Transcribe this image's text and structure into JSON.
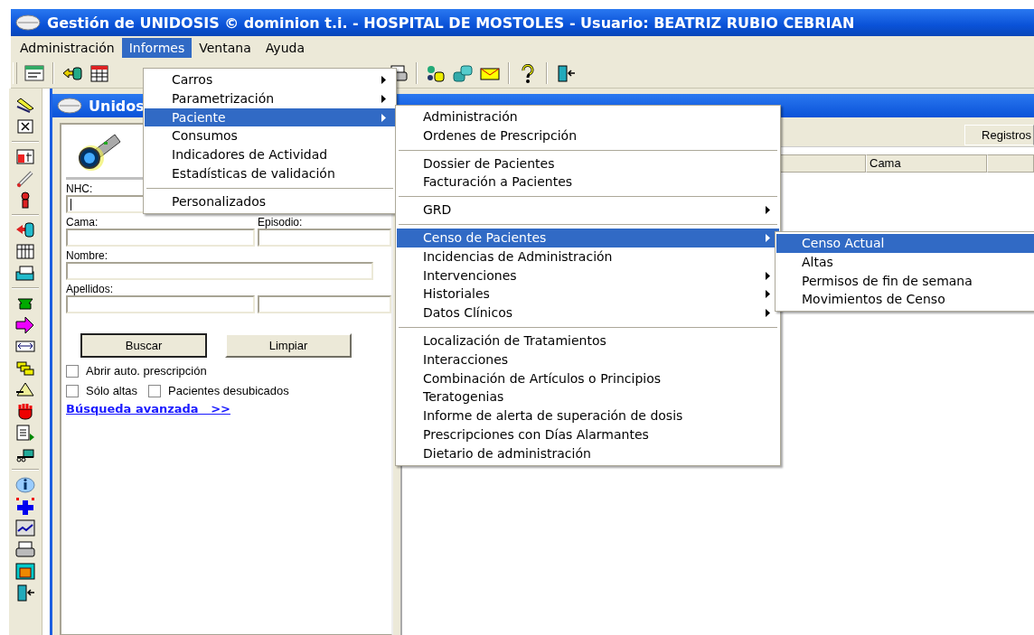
{
  "window": {
    "title": "Gestión de UNIDOSIS © dominion t.i. - HOSPITAL DE MOSTOLES - Usuario: BEATRIZ RUBIO CEBRIAN"
  },
  "menubar": [
    {
      "label": "Administración",
      "selected": false
    },
    {
      "label": "Informes",
      "selected": true
    },
    {
      "label": "Ventana",
      "selected": false
    },
    {
      "label": "Ayuda",
      "selected": false
    }
  ],
  "child_window": {
    "title": "Unidos"
  },
  "search_form": {
    "fields": [
      {
        "label": "NHC:",
        "kind": "full",
        "focused": true
      },
      {
        "label": "Cama:",
        "kind": "half"
      },
      {
        "label": "Episodio:",
        "kind": "half"
      },
      {
        "label": "Nombre:",
        "kind": "wide"
      },
      {
        "label": "Apellidos:",
        "kind": "half"
      },
      {
        "kind": "half"
      }
    ],
    "buttons": [
      {
        "label": "Buscar",
        "default": true
      },
      {
        "label": "Limpiar",
        "default": false
      }
    ],
    "checkboxes": [
      [
        {
          "label": "Abrir auto. prescripción",
          "checked": false
        }
      ],
      [
        {
          "label": "Sólo altas",
          "checked": false
        },
        {
          "label": "Pacientes desubicados",
          "checked": false
        }
      ]
    ],
    "link": "Búsqueda avanzada   >>"
  },
  "results": {
    "button": "Registros",
    "columns": [
      "Cama"
    ]
  },
  "menus": [
    {
      "items": [
        {
          "kind": "item",
          "label": "Carros",
          "submenu": true,
          "selected": false
        },
        {
          "kind": "item",
          "label": "Parametrización",
          "submenu": true,
          "selected": false
        },
        {
          "kind": "item",
          "label": "Paciente",
          "submenu": true,
          "selected": true
        },
        {
          "kind": "item",
          "label": "Consumos",
          "submenu": false,
          "selected": false
        },
        {
          "kind": "item",
          "label": "Indicadores de Actividad",
          "submenu": false,
          "selected": false
        },
        {
          "kind": "item",
          "label": "Estadísticas de validación",
          "submenu": false,
          "selected": false
        },
        {
          "kind": "separator"
        },
        {
          "kind": "item",
          "label": "Personalizados",
          "submenu": false,
          "selected": false
        }
      ]
    },
    {
      "items": [
        {
          "kind": "item",
          "label": "Administración",
          "submenu": false,
          "selected": false
        },
        {
          "kind": "item",
          "label": "Ordenes de Prescripción",
          "submenu": false,
          "selected": false
        },
        {
          "kind": "separator"
        },
        {
          "kind": "item",
          "label": "Dossier de Pacientes",
          "submenu": false,
          "selected": false
        },
        {
          "kind": "item",
          "label": "Facturación a Pacientes",
          "submenu": false,
          "selected": false
        },
        {
          "kind": "separator"
        },
        {
          "kind": "item",
          "label": "GRD",
          "submenu": true,
          "selected": false
        },
        {
          "kind": "separator"
        },
        {
          "kind": "item",
          "label": "Censo de Pacientes",
          "submenu": true,
          "selected": true
        },
        {
          "kind": "item",
          "label": "Incidencias de Administración",
          "submenu": false,
          "selected": false
        },
        {
          "kind": "item",
          "label": "Intervenciones",
          "submenu": true,
          "selected": false
        },
        {
          "kind": "item",
          "label": "Historiales",
          "submenu": true,
          "selected": false
        },
        {
          "kind": "item",
          "label": "Datos Clínicos",
          "submenu": true,
          "selected": false
        },
        {
          "kind": "separator"
        },
        {
          "kind": "item",
          "label": "Localización de Tratamientos",
          "submenu": false,
          "selected": false
        },
        {
          "kind": "item",
          "label": "Interacciones",
          "submenu": false,
          "selected": false
        },
        {
          "kind": "item",
          "label": "Combinación de Artículos o Principios",
          "submenu": false,
          "selected": false
        },
        {
          "kind": "item",
          "label": "Teratogenias",
          "submenu": false,
          "selected": false
        },
        {
          "kind": "item",
          "label": "Informe de alerta de superación de dosis",
          "submenu": false,
          "selected": false
        },
        {
          "kind": "item",
          "label": "Prescripciones con Días Alarmantes",
          "submenu": false,
          "selected": false
        },
        {
          "kind": "item",
          "label": "Dietario de administración",
          "submenu": false,
          "selected": false
        }
      ]
    },
    {
      "items": [
        {
          "kind": "item",
          "label": "Censo Actual",
          "submenu": false,
          "selected": true
        },
        {
          "kind": "item",
          "label": "Altas",
          "submenu": false,
          "selected": false
        },
        {
          "kind": "item",
          "label": "Permisos de fin de semana",
          "submenu": false,
          "selected": false
        },
        {
          "kind": "item",
          "label": "Movimientos de Censo",
          "submenu": false,
          "selected": false
        }
      ]
    }
  ]
}
